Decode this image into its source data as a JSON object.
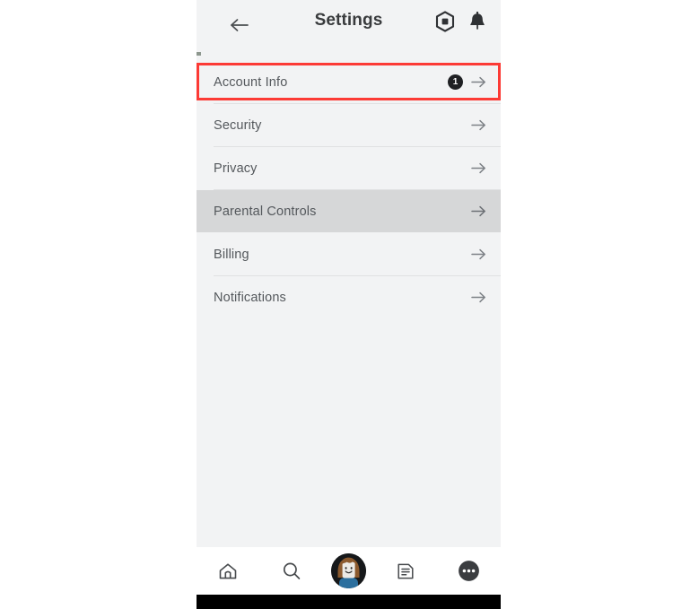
{
  "header": {
    "title": "Settings",
    "back_icon": "arrow-left-icon",
    "logo_icon": "roblox-logo-icon",
    "bell_icon": "bell-icon"
  },
  "settings": {
    "items": [
      {
        "label": "Account Info",
        "badge": "1",
        "chevron": "arrow-right-icon",
        "highlighted": true,
        "hovered": false
      },
      {
        "label": "Security",
        "badge": "",
        "chevron": "arrow-right-icon",
        "highlighted": false,
        "hovered": false
      },
      {
        "label": "Privacy",
        "badge": "",
        "chevron": "arrow-right-icon",
        "highlighted": false,
        "hovered": false
      },
      {
        "label": "Parental Controls",
        "badge": "",
        "chevron": "arrow-right-icon",
        "highlighted": false,
        "hovered": true
      },
      {
        "label": "Billing",
        "badge": "",
        "chevron": "arrow-right-icon",
        "highlighted": false,
        "hovered": false
      },
      {
        "label": "Notifications",
        "badge": "",
        "chevron": "arrow-right-icon",
        "highlighted": false,
        "hovered": false
      }
    ]
  },
  "bottom_nav": {
    "items": [
      {
        "name": "home",
        "icon": "home-icon"
      },
      {
        "name": "search",
        "icon": "search-icon"
      },
      {
        "name": "avatar",
        "icon": "avatar-icon"
      },
      {
        "name": "chat",
        "icon": "chat-icon"
      },
      {
        "name": "more",
        "icon": "more-dots-icon"
      }
    ]
  },
  "colors": {
    "background": "#f2f3f4",
    "highlight_border": "#fc3a35",
    "hover_row": "#d6d7d8",
    "badge_bg": "#1f2023",
    "text": "#54585c",
    "title_text": "#393b3d",
    "accent_strip": "#8d978e"
  }
}
